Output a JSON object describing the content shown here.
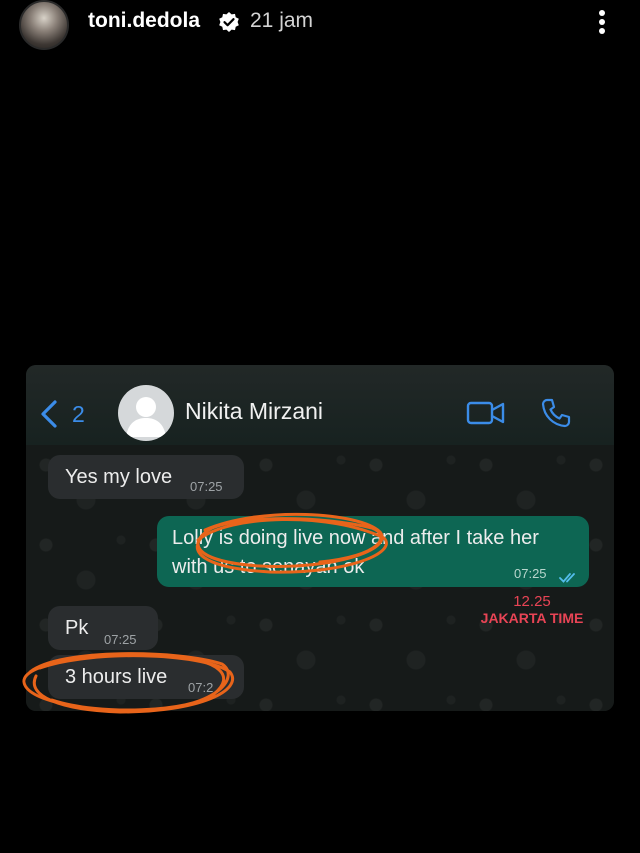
{
  "story": {
    "username": "toni.dedola",
    "time_ago": "21 jam"
  },
  "chat": {
    "unread_count": "2",
    "contact_name": "Nikita Mirzani",
    "messages": [
      {
        "direction": "in",
        "lines": [
          "Yes my love"
        ],
        "time": "07:25"
      },
      {
        "direction": "out",
        "lines": [
          "Lolly is doing live now and after I take her",
          "with us to senayan ok"
        ],
        "time": "07:25"
      },
      {
        "direction": "in",
        "lines": [
          "Pk"
        ],
        "time": "07:25"
      },
      {
        "direction": "in",
        "lines": [
          "3 hours live"
        ],
        "time": "07:2"
      }
    ]
  },
  "annotation": {
    "time": "12.25",
    "zone": "JAKARTA TIME",
    "color": "#e84455",
    "scribble_color": "#e8641a"
  },
  "colors": {
    "accent_blue": "#3b8ce8",
    "outgoing_bubble": "#0d6653",
    "incoming_bubble": "#2a2d2f"
  }
}
